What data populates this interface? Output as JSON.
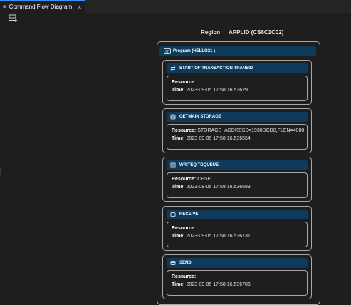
{
  "tab": {
    "label": "Command Flow Diagram",
    "close": "×",
    "icon": "menu-icon"
  },
  "toolbar": {
    "icon": "flow-layout-icon"
  },
  "region": {
    "label": "Region",
    "value": "APPLID (CS6C1C02)"
  },
  "program": {
    "label": "Program (HELLO21 )",
    "icon": "program-icon"
  },
  "cards": [
    {
      "title": "START OF TRANSACTION TRANSID",
      "icon": "transfer-icon",
      "resource_label": "Resource:",
      "resource": "",
      "time_label": "Time:",
      "time": "2023-09-05 17:58:16.53629"
    },
    {
      "title": "GETMAIN STORAGE",
      "icon": "storage-icon",
      "resource_label": "Resource:",
      "resource": "STORAGE_ADDRESS=1930DCD8,FLEN=4080",
      "time_label": "Time:",
      "time": "2023-09-05 17:58:16.536554"
    },
    {
      "title": "WRITEQ TDQUEUE",
      "icon": "queue-icon",
      "resource_label": "Resource:",
      "resource": "CESE",
      "time_label": "Time:",
      "time": "2023-09-05 17:58:16.536683"
    },
    {
      "title": "RECEIVE",
      "icon": "terminal-icon",
      "resource_label": "Resource:",
      "resource": "",
      "time_label": "Time:",
      "time": "2023-09-05 17:58:16.536731"
    },
    {
      "title": "SEND",
      "icon": "terminal-icon",
      "resource_label": "Resource:",
      "resource": "",
      "time_label": "Time:",
      "time": "2023-09-05 17:58:16.536786"
    }
  ]
}
